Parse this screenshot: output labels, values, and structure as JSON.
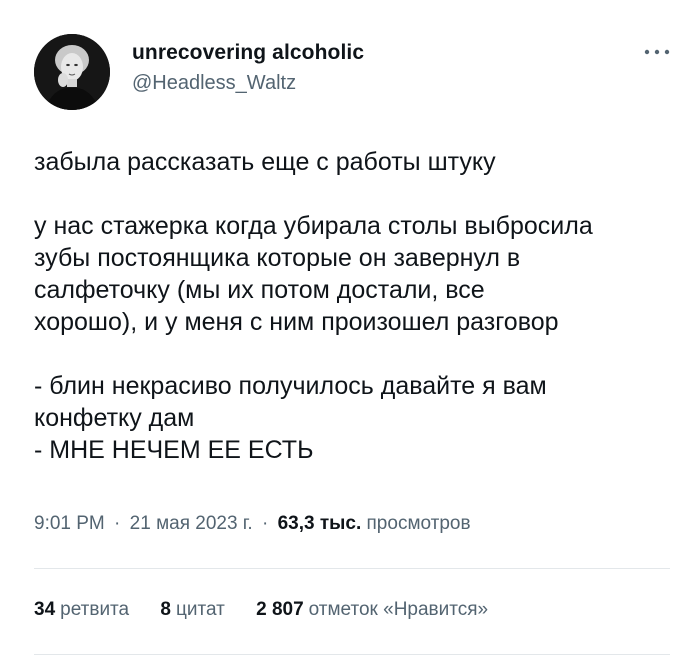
{
  "author": {
    "display_name": "unrecovering alcoholic",
    "handle": "@Headless_Waltz"
  },
  "tweet": {
    "paragraphs": [
      "забыла рассказать еще с работы штуку",
      "у нас стажерка когда убирала столы выбросила\nзубы постоянщика которые он завернул в\nсалфеточку (мы их потом достали, все\nхорошо), и у меня с ним произошел разговор",
      "- блин некрасиво получилось давайте я вам\nконфетку дам\n- МНЕ НЕЧЕМ ЕЕ ЕСТЬ"
    ]
  },
  "meta": {
    "time": "9:01 PM",
    "separator": "·",
    "date": "21 мая 2023 г.",
    "views_count": "63,3 тыс.",
    "views_label": "просмотров"
  },
  "stats": {
    "retweets_count": "34",
    "retweets_label": "ретвита",
    "quotes_count": "8",
    "quotes_label": "цитат",
    "likes_count": "2 807",
    "likes_label": "отметок «Нравится»"
  },
  "icons": {
    "more": "more-horizontal-icon"
  },
  "colors": {
    "text": "#0f1419",
    "secondary": "#536471",
    "divider": "#e3e7ea"
  }
}
